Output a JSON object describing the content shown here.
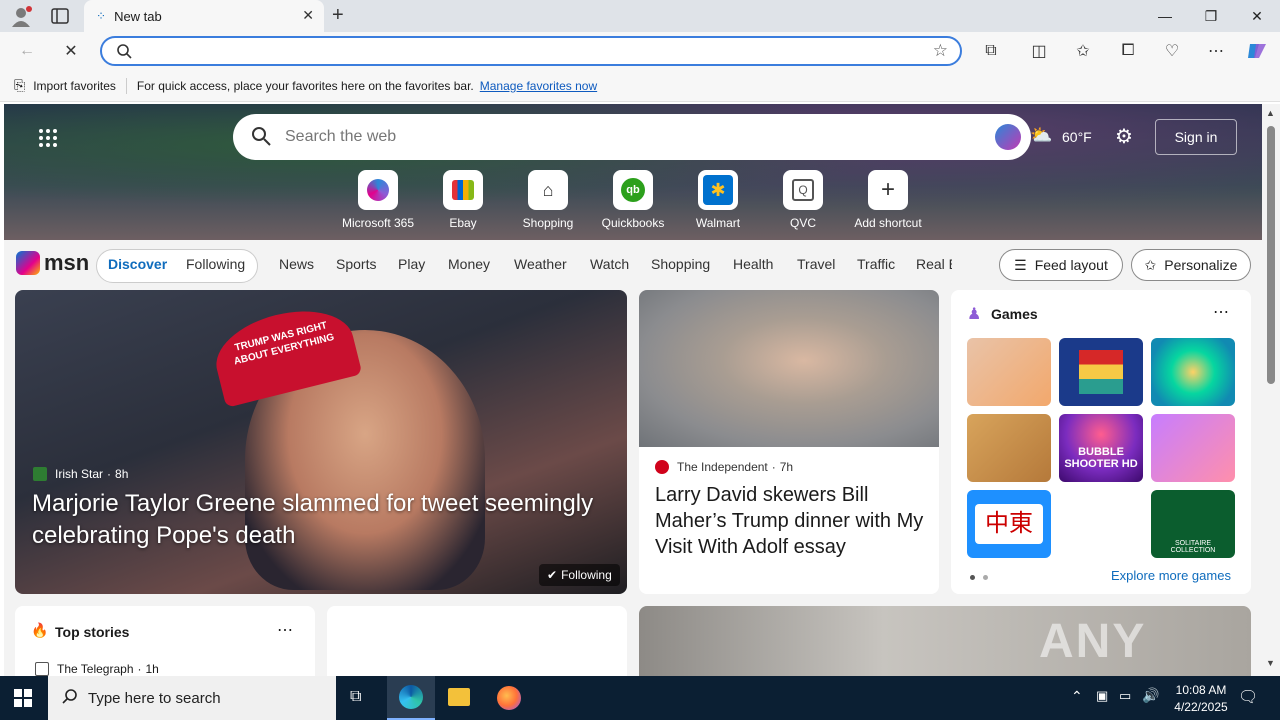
{
  "browser": {
    "tab_title": "New tab",
    "favbar_import": "Import favorites",
    "favbar_message": "For quick access, place your favorites here on the favorites bar.",
    "favbar_link": "Manage favorites now"
  },
  "hero": {
    "search_placeholder": "Search the web",
    "temperature": "60°F",
    "sign_in": "Sign in",
    "shortcuts": [
      {
        "label": "Microsoft 365",
        "icon": "microsoft365-icon"
      },
      {
        "label": "Ebay",
        "icon": "ebay-icon"
      },
      {
        "label": "Shopping",
        "icon": "shopping-tag-icon"
      },
      {
        "label": "Quickbooks",
        "icon": "quickbooks-icon"
      },
      {
        "label": "Walmart",
        "icon": "walmart-icon"
      },
      {
        "label": "QVC",
        "icon": "qvc-icon"
      },
      {
        "label": "Add shortcut",
        "icon": "plus-icon"
      }
    ]
  },
  "nav": {
    "logo": "msn",
    "discover": "Discover",
    "following": "Following",
    "items": [
      "News",
      "Sports",
      "Play",
      "Money",
      "Weather",
      "Watch",
      "Shopping",
      "Health",
      "Travel",
      "Traffic",
      "Real E"
    ],
    "feed_layout": "Feed layout",
    "personalize": "Personalize"
  },
  "main_story": {
    "source": "Irish Star",
    "age": "8h",
    "headline": "Marjorie Taylor Greene slammed for tweet seemingly celebrating Pope's death",
    "following": "Following",
    "hat_text": "TRUMP WAS RIGHT ABOUT EVERYTHING"
  },
  "side_story": {
    "source": "The Independent",
    "age": "7h",
    "headline": "Larry David skewers Bill Maher’s Trump dinner with My Visit With Adolf essay"
  },
  "games": {
    "title": "Games",
    "explore": "Explore more games",
    "bubble_label": "BUBBLE SHOOTER HD",
    "solitaire_label": "SOLITAIRE COLLECTION",
    "mahjong_label": "中東"
  },
  "top_stories": {
    "title": "Top stories",
    "source": "The Telegraph",
    "age": "1h"
  },
  "watermark": "ANY RUN",
  "taskbar": {
    "search_placeholder": "Type here to search",
    "time": "10:08 AM",
    "date": "4/22/2025"
  },
  "colors": {
    "accent": "#0f6cbd",
    "address_border": "#3b7ddd",
    "taskbar": "#0b1f33"
  }
}
